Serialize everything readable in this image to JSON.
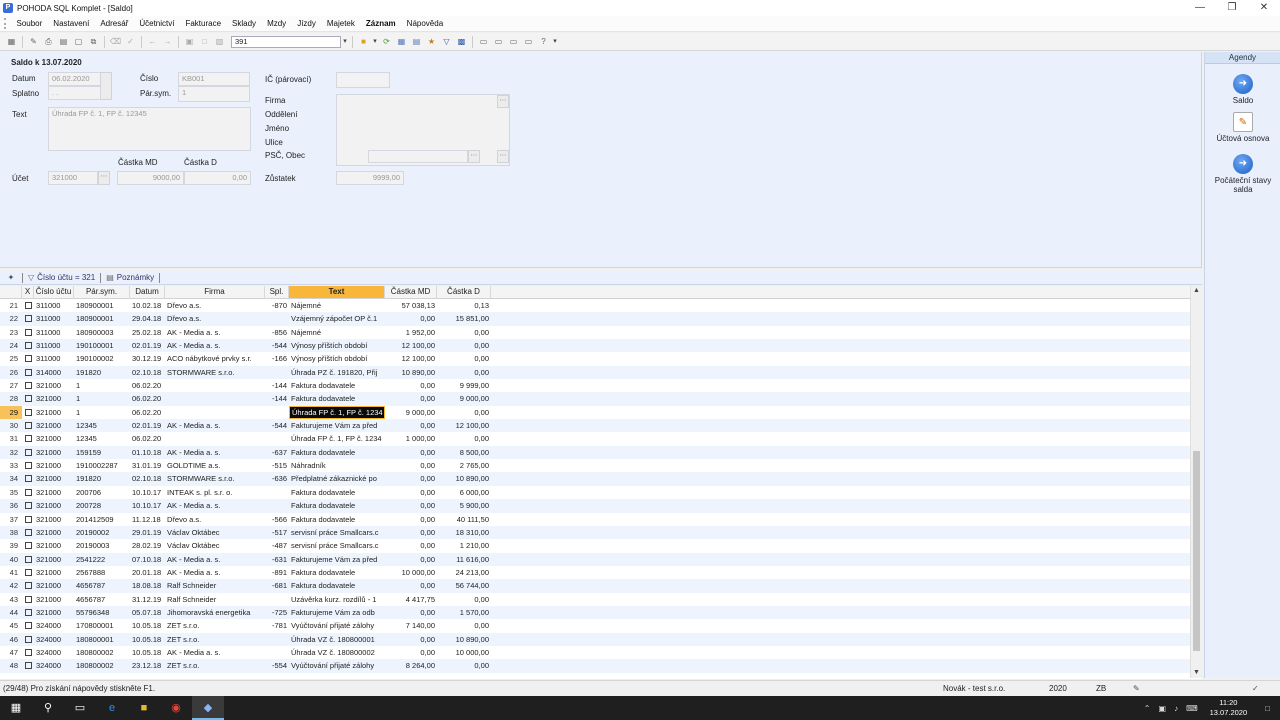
{
  "window": {
    "title": "POHODA SQL Komplet - [Saldo]",
    "app_icon": "pohoda-icon"
  },
  "menu": [
    "Soubor",
    "Nastavení",
    "Adresář",
    "Účetnictví",
    "Fakturace",
    "Sklady",
    "Mzdy",
    "Jízdy",
    "Majetek",
    "Záznam",
    "Nápověda"
  ],
  "toolbar": {
    "record_value": "391"
  },
  "form": {
    "heading": "Saldo k 13.07.2020",
    "datum_label": "Datum",
    "datum_value": "06.02.2020",
    "splatno_label": "Splatno",
    "splatno_value": " .  .",
    "cislo_label": "Číslo",
    "cislo_value": "KB001",
    "parsym_label": "Pár.sym.",
    "parsym_value": "1",
    "text_label": "Text",
    "text_value": "Úhrada FP č. 1, FP č. 12345",
    "castka_md_label": "Částka MD",
    "castka_d_label": "Částka D",
    "ucet_label": "Účet",
    "ucet_value": "321000",
    "castka_md_value": "9000,00",
    "castka_d_value": "0,00",
    "ic_label": "IČ (párovací)",
    "ic_value": "",
    "firma_label": "Firma",
    "oddeleni_label": "Oddělení",
    "jmeno_label": "Jméno",
    "ulice_label": "Ulice",
    "psc_label": "PSČ, Obec",
    "zustatek_label": "Zůstatek",
    "zustatek_value": "9999,00"
  },
  "agendy": {
    "title": "Agendy",
    "items": [
      {
        "label": "Saldo",
        "icon": "saldo-icon"
      },
      {
        "label": "Účtová osnova",
        "icon": "account-chart-icon"
      },
      {
        "label": "Počáteční stavy salda",
        "icon": "initial-balance-icon"
      }
    ]
  },
  "filter_tabs": [
    {
      "label": "Číslo účtu = 321",
      "icon": "filter-icon"
    },
    {
      "label": "Poznámky",
      "icon": "notes-icon"
    }
  ],
  "grid": {
    "columns": [
      "",
      "X",
      "Číslo účtu",
      "Pár.sym.",
      "Datum",
      "Firma",
      "Spl.",
      "Text",
      "Částka MD",
      "Částka D"
    ],
    "selected_row": "29",
    "rows": [
      [
        "21",
        "311000",
        "180900001",
        "10.02.18",
        "Dřevo a.s.",
        "-870",
        "Nájemné",
        "57 038,13",
        "0,13"
      ],
      [
        "22",
        "311000",
        "180900001",
        "29.04.18",
        "Dřevo a.s.",
        "",
        "Vzájemný zápočet OP č.1",
        "0,00",
        "15 851,00"
      ],
      [
        "23",
        "311000",
        "180900003",
        "25.02.18",
        "AK - Media a. s.",
        "-856",
        "Nájemné",
        "1 952,00",
        "0,00"
      ],
      [
        "24",
        "311000",
        "190100001",
        "02.01.19",
        "AK - Media a. s.",
        "-544",
        "Výnosy příštích období",
        "12 100,00",
        "0,00"
      ],
      [
        "25",
        "311000",
        "190100002",
        "30.12.19",
        "ACO nábytkové prvky s.r.",
        "-166",
        "Výnosy příštích období",
        "12 100,00",
        "0,00"
      ],
      [
        "26",
        "314000",
        "191820",
        "02.10.18",
        "STORMWARE s.r.o.",
        "",
        "Úhrada PZ č. 191820, Přij",
        "10 890,00",
        "0,00"
      ],
      [
        "27",
        "321000",
        "1",
        "06.02.20",
        "",
        "-144",
        "Faktura dodavatele",
        "0,00",
        "9 999,00"
      ],
      [
        "28",
        "321000",
        "1",
        "06.02.20",
        "",
        "-144",
        "Faktura dodavatele",
        "0,00",
        "9 000,00"
      ],
      [
        "29",
        "321000",
        "1",
        "06.02.20",
        "",
        "",
        "Úhrada FP č. 1, FP č. 1234",
        "9 000,00",
        "0,00"
      ],
      [
        "30",
        "321000",
        "12345",
        "02.01.19",
        "AK - Media a. s.",
        "-544",
        "Fakturujeme Vám za před",
        "0,00",
        "12 100,00"
      ],
      [
        "31",
        "321000",
        "12345",
        "06.02.20",
        "",
        "",
        "Úhrada FP č. 1, FP č. 1234",
        "1 000,00",
        "0,00"
      ],
      [
        "32",
        "321000",
        "159159",
        "01.10.18",
        "AK - Media a. s.",
        "-637",
        "Faktura dodavatele",
        "0,00",
        "8 500,00"
      ],
      [
        "33",
        "321000",
        "1910002287",
        "31.01.19",
        "GOLDTIME a.s.",
        "-515",
        "Náhradník",
        "0,00",
        "2 765,00"
      ],
      [
        "34",
        "321000",
        "191820",
        "02.10.18",
        "STORMWARE s.r.o.",
        "-636",
        "Předplatné zákaznické po",
        "0,00",
        "10 890,00"
      ],
      [
        "35",
        "321000",
        "200706",
        "10.10.17",
        "INTEAK s. pl. s.r. o.",
        "",
        "Faktura dodavatele",
        "0,00",
        "6 000,00"
      ],
      [
        "36",
        "321000",
        "200728",
        "10.10.17",
        "AK - Media a. s.",
        "",
        "Faktura dodavatele",
        "0,00",
        "5 900,00"
      ],
      [
        "37",
        "321000",
        "201412509",
        "11.12.18",
        "Dřevo a.s.",
        "-566",
        "Faktura dodavatele",
        "0,00",
        "40 111,50"
      ],
      [
        "38",
        "321000",
        "20190002",
        "29.01.19",
        "Václav Oktábec",
        "-517",
        "servisní práce Smallcars.c",
        "0,00",
        "18 310,00"
      ],
      [
        "39",
        "321000",
        "20190003",
        "28.02.19",
        "Václav Oktábec",
        "-487",
        "servisní práce Smallcars.c",
        "0,00",
        "1 210,00"
      ],
      [
        "40",
        "321000",
        "2541222",
        "07.10.18",
        "AK - Media a. s.",
        "-631",
        "Fakturujeme Vám za před",
        "0,00",
        "11 616,00"
      ],
      [
        "41",
        "321000",
        "2567888",
        "20.01.18",
        "AK - Media a. s.",
        "-891",
        "Faktura dodavatele",
        "10 000,00",
        "24 213,00"
      ],
      [
        "42",
        "321000",
        "4656787",
        "18.08.18",
        "Ralf Schneider",
        "-681",
        "Faktura dodavatele",
        "0,00",
        "56 744,00"
      ],
      [
        "43",
        "321000",
        "4656787",
        "31.12.19",
        "Ralf Schneider",
        "",
        "Uzávěrka kurz. rozdílů - 1",
        "4 417,75",
        "0,00"
      ],
      [
        "44",
        "321000",
        "55796348",
        "05.07.18",
        "Jihomoravská energetika",
        "-725",
        "Fakturujeme Vám za odb",
        "0,00",
        "1 570,00"
      ],
      [
        "45",
        "324000",
        "170800001",
        "10.05.18",
        "ZET s.r.o.",
        "-781",
        "Vyúčtování přijaté zálohy",
        "7 140,00",
        "0,00"
      ],
      [
        "46",
        "324000",
        "180800001",
        "10.05.18",
        "ZET s.r.o.",
        "",
        "Úhrada VZ č. 180800001",
        "0,00",
        "10 890,00"
      ],
      [
        "47",
        "324000",
        "180800002",
        "10.05.18",
        "AK - Media a. s.",
        "",
        "Úhrada VZ č. 180800002",
        "0,00",
        "10 000,00"
      ],
      [
        "48",
        "324000",
        "180800002",
        "23.12.18",
        "ZET s.r.o.",
        "-554",
        "Vyúčtování přijaté zálohy",
        "8 264,00",
        "0,00"
      ]
    ]
  },
  "status": {
    "hint": "(29/48) Pro získání nápovědy stiskněte F1.",
    "user": "Novák - test s.r.o.",
    "year": "2020",
    "mode": "ZB"
  },
  "taskbar": {
    "time": "11:20",
    "date": "13.07.2020",
    "items": [
      "start-icon",
      "search-icon",
      "task-view-icon",
      "edge-icon",
      "explorer-icon",
      "chrome-icon",
      "pohoda-icon"
    ]
  },
  "colors": {
    "form_bg": "#eaf1fc",
    "active_column": "#f8b73a",
    "row_alt": "#eef4fd"
  }
}
